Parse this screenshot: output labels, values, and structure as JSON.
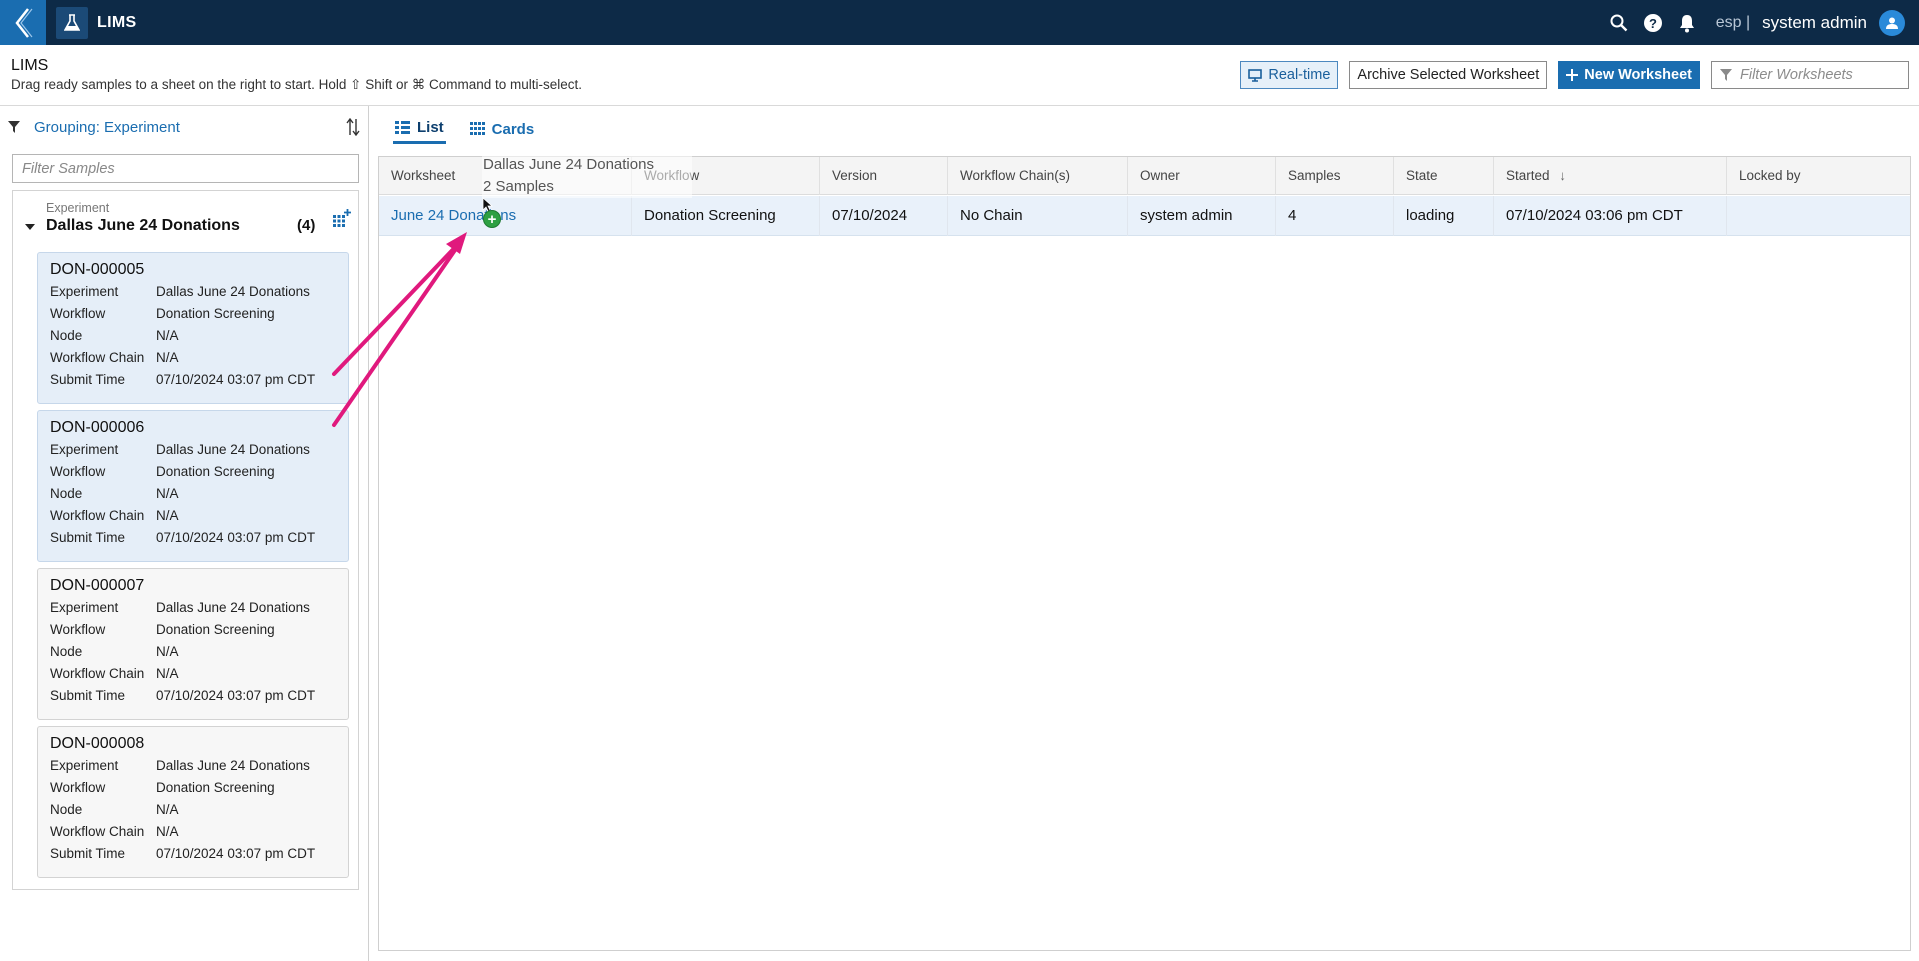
{
  "topbar": {
    "app_name": "LIMS",
    "workspace": "esp",
    "separator": "|",
    "user": "system admin"
  },
  "header": {
    "title": "LIMS",
    "subtitle": "Drag ready samples to a sheet on the right to start. Hold ⇧ Shift or ⌘ Command to multi-select.",
    "realtime_label": "Real-time",
    "archive_label": "Archive Selected Worksheet",
    "new_worksheet_label": "New Worksheet",
    "filter_placeholder": "Filter Worksheets"
  },
  "left": {
    "grouping_label": "Grouping: Experiment",
    "filter_placeholder": "Filter Samples",
    "group": {
      "type_label": "Experiment",
      "name": "Dallas June 24 Donations",
      "count": "(4)"
    },
    "field_labels": {
      "experiment": "Experiment",
      "workflow": "Workflow",
      "node": "Node",
      "chain": "Workflow Chain",
      "submit": "Submit Time"
    },
    "samples": [
      {
        "id": "DON-000005",
        "experiment": "Dallas June 24 Donations",
        "workflow": "Donation Screening",
        "node": "N/A",
        "chain": "N/A",
        "submit": "07/10/2024 03:07 pm CDT",
        "selected": true
      },
      {
        "id": "DON-000006",
        "experiment": "Dallas June 24 Donations",
        "workflow": "Donation Screening",
        "node": "N/A",
        "chain": "N/A",
        "submit": "07/10/2024 03:07 pm CDT",
        "selected": true
      },
      {
        "id": "DON-000007",
        "experiment": "Dallas June 24 Donations",
        "workflow": "Donation Screening",
        "node": "N/A",
        "chain": "N/A",
        "submit": "07/10/2024 03:07 pm CDT",
        "selected": false
      },
      {
        "id": "DON-000008",
        "experiment": "Dallas June 24 Donations",
        "workflow": "Donation Screening",
        "node": "N/A",
        "chain": "N/A",
        "submit": "07/10/2024 03:07 pm CDT",
        "selected": false
      }
    ]
  },
  "right": {
    "tabs": {
      "list": "List",
      "cards": "Cards"
    },
    "columns": {
      "worksheet": "Worksheet",
      "workflow": "Workflow",
      "version": "Version",
      "chain": "Workflow Chain(s)",
      "owner": "Owner",
      "samples": "Samples",
      "state": "State",
      "started": "Started",
      "sort_arrow": "↓",
      "locked": "Locked by"
    },
    "rows": [
      {
        "worksheet": "June 24 Donations",
        "workflow": "Donation Screening",
        "version": "07/10/2024",
        "chain": "No Chain",
        "owner": "system admin",
        "samples": "4",
        "state": "loading",
        "started": "07/10/2024 03:06 pm CDT",
        "locked": ""
      }
    ]
  },
  "drag": {
    "title": "Dallas June 24 Donations",
    "count": "2 Samples",
    "plus": "+"
  },
  "colors": {
    "topbar": "#0d2a47",
    "accent": "#1a6db0",
    "selected_card": "#e5eef8",
    "annotation_arrow": "#e0197d"
  }
}
